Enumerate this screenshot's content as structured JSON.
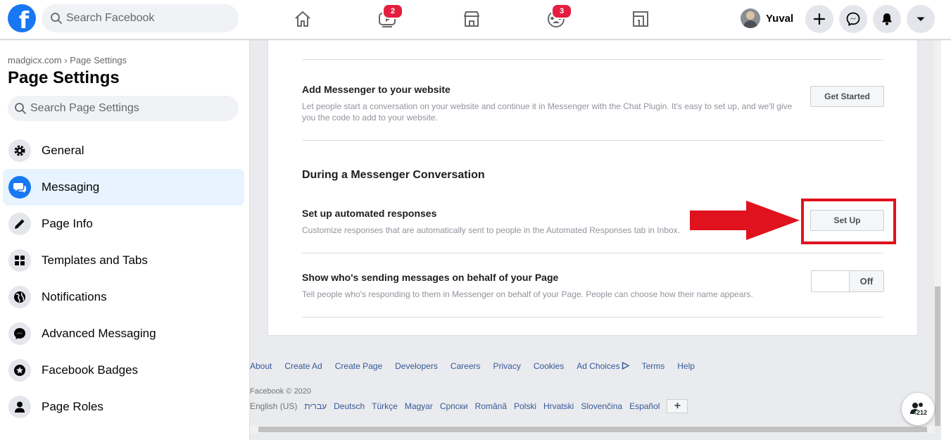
{
  "header": {
    "logo_letter": "f",
    "search_placeholder": "Search Facebook",
    "nav": [
      {
        "name": "home",
        "badge": ""
      },
      {
        "name": "watch",
        "badge": "2"
      },
      {
        "name": "marketplace",
        "badge": ""
      },
      {
        "name": "groups",
        "badge": "3"
      },
      {
        "name": "gaming",
        "badge": ""
      }
    ],
    "profile_name": "Yuval"
  },
  "sidebar": {
    "breadcrumb": "madgicx.com › Page Settings",
    "title": "Page Settings",
    "search_placeholder": "Search Page Settings",
    "items": [
      {
        "label": "General",
        "icon": "gear-icon"
      },
      {
        "label": "Messaging",
        "icon": "messaging-icon"
      },
      {
        "label": "Page Info",
        "icon": "pencil-icon"
      },
      {
        "label": "Templates and Tabs",
        "icon": "grid-icon"
      },
      {
        "label": "Notifications",
        "icon": "globe-icon"
      },
      {
        "label": "Advanced Messaging",
        "icon": "messenger-icon"
      },
      {
        "label": "Facebook Badges",
        "icon": "badge-icon"
      },
      {
        "label": "Page Roles",
        "icon": "person-icon"
      }
    ]
  },
  "main": {
    "add_messenger": {
      "title": "Add Messenger to your website",
      "desc": "Let people start a conversation on your website and continue it in Messenger with the Chat Plugin. It's easy to set up, and we'll give you the code to add to your website.",
      "button": "Get Started"
    },
    "section_title": "During a Messenger Conversation",
    "automated": {
      "title": "Set up automated responses",
      "desc": "Customize responses that are automatically sent to people in the Automated Responses tab in Inbox.",
      "button": "Set Up"
    },
    "behalf": {
      "title": "Show who's sending messages on behalf of your Page",
      "desc": "Tell people who's responding to them in Messenger on behalf of your Page. People can choose how their name appears.",
      "toggle": "Off"
    }
  },
  "footer": {
    "links": [
      "About",
      "Create Ad",
      "Create Page",
      "Developers",
      "Careers",
      "Privacy",
      "Cookies",
      "Ad Choices",
      "Terms",
      "Help"
    ],
    "copyright": "Facebook © 2020",
    "current_language": "English (US)",
    "languages": [
      "עברית",
      "Deutsch",
      "Türkçe",
      "Magyar",
      "Српски",
      "Română",
      "Polski",
      "Hrvatski",
      "Slovenčina",
      "Español"
    ],
    "lang_more": "+"
  },
  "chat_widget": {
    "count": "212"
  },
  "colors": {
    "brand": "#1877f2",
    "badge": "#e41e3f",
    "annotation": "#e0121e"
  }
}
